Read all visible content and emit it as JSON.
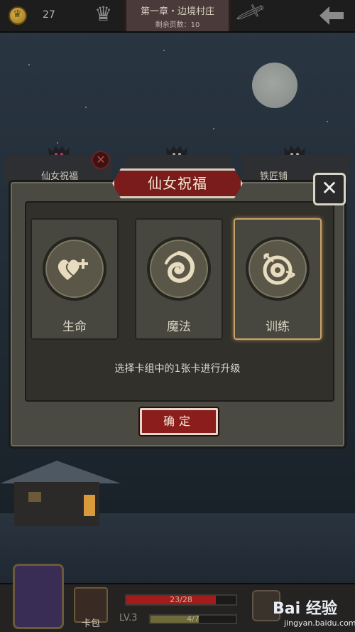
{
  "topbar": {
    "coin_count": "27",
    "chapter_title": "第一章・边境村庄",
    "pages_left": "剩余页数：10"
  },
  "tabs": {
    "left_label": "仙女祝福",
    "right_label": "铁匠铺"
  },
  "modal": {
    "title": "仙女祝福",
    "options": [
      {
        "label": "生命",
        "icon": "heart-plus-icon",
        "selected": false
      },
      {
        "label": "魔法",
        "icon": "swirl-icon",
        "selected": false
      },
      {
        "label": "训练",
        "icon": "training-dummy-icon",
        "selected": true
      }
    ],
    "hint": "选择卡组中的1张卡进行升级",
    "confirm_label": "确定"
  },
  "bottombar": {
    "deck_label": "卡包",
    "hp_text": "23/28",
    "hp_fraction": 0.82,
    "level_label": "LV.3",
    "xp_text": "4/7",
    "xp_fraction": 0.57
  },
  "watermark": {
    "brand": "Bai 经验",
    "url": "jingyan.baidu.com"
  },
  "colors": {
    "accent_red": "#8c1d1d",
    "selection_gold": "#c8a368",
    "panel": "#4a4942"
  }
}
